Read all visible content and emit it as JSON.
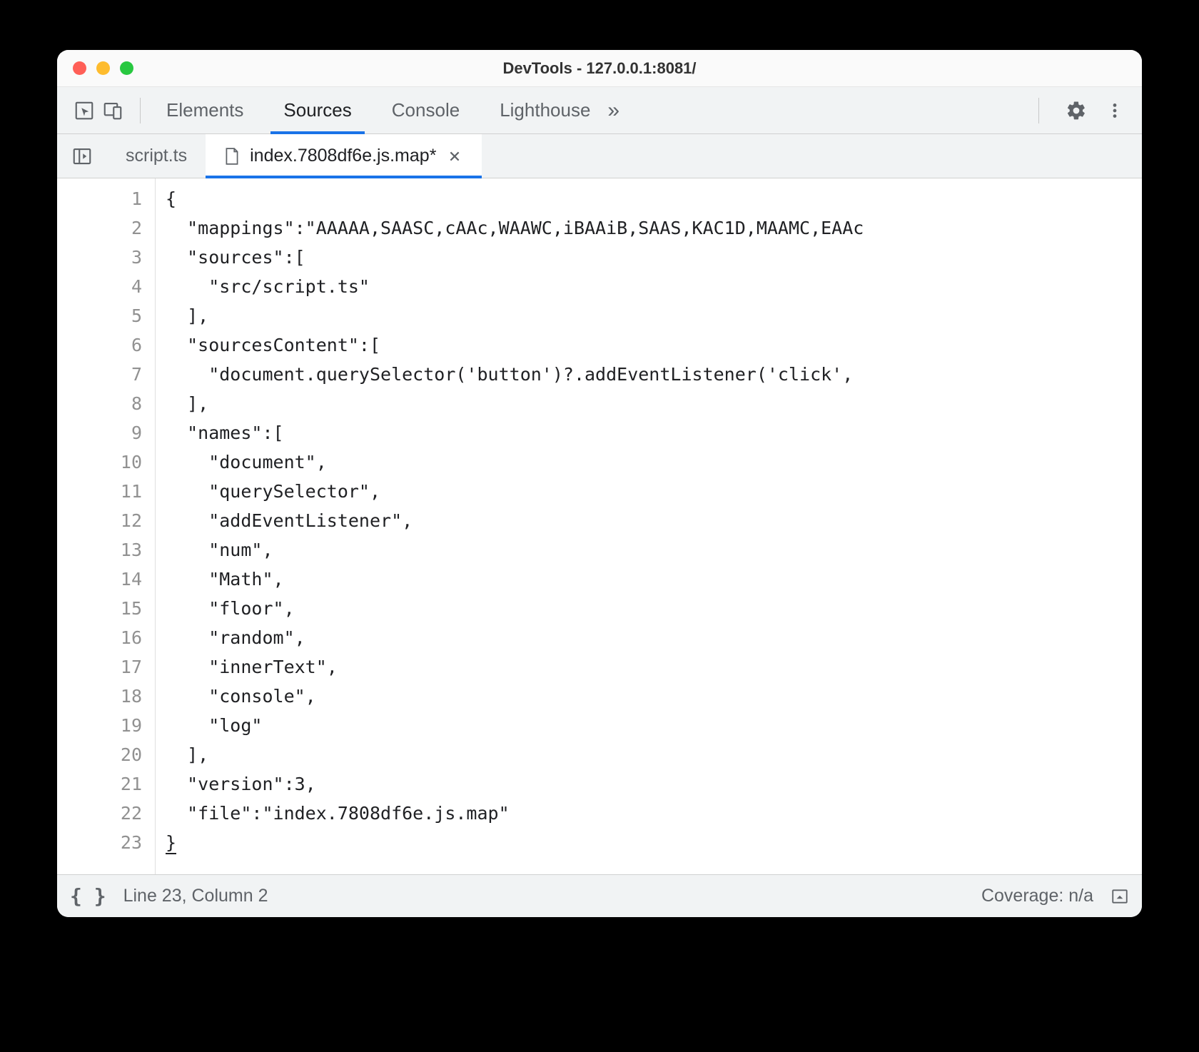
{
  "window": {
    "title": "DevTools - 127.0.0.1:8081/"
  },
  "toolbar": {
    "tabs": [
      {
        "label": "Elements",
        "active": false
      },
      {
        "label": "Sources",
        "active": true
      },
      {
        "label": "Console",
        "active": false
      },
      {
        "label": "Lighthouse",
        "active": false
      }
    ],
    "overflow_glyph": "»"
  },
  "filetabs": [
    {
      "label": "script.ts",
      "active": false,
      "modified": false,
      "hasIcon": false,
      "closeable": false
    },
    {
      "label": "index.7808df6e.js.map*",
      "active": true,
      "modified": true,
      "hasIcon": true,
      "closeable": true
    }
  ],
  "editor": {
    "lines": [
      "{",
      "  \"mappings\":\"AAAAA,SAASC,cAAc,WAAWC,iBAAiB,SAAS,KAC1D,MAAMC,EAAc",
      "  \"sources\":[",
      "    \"src/script.ts\"",
      "  ],",
      "  \"sourcesContent\":[",
      "    \"document.querySelector('button')?.addEventListener('click',",
      "  ],",
      "  \"names\":[",
      "    \"document\",",
      "    \"querySelector\",",
      "    \"addEventListener\",",
      "    \"num\",",
      "    \"Math\",",
      "    \"floor\",",
      "    \"random\",",
      "    \"innerText\",",
      "    \"console\",",
      "    \"log\"",
      "  ],",
      "  \"version\":3,",
      "  \"file\":\"index.7808df6e.js.map\"",
      "}"
    ]
  },
  "statusbar": {
    "position": "Line 23, Column 2",
    "coverage": "Coverage: n/a"
  }
}
